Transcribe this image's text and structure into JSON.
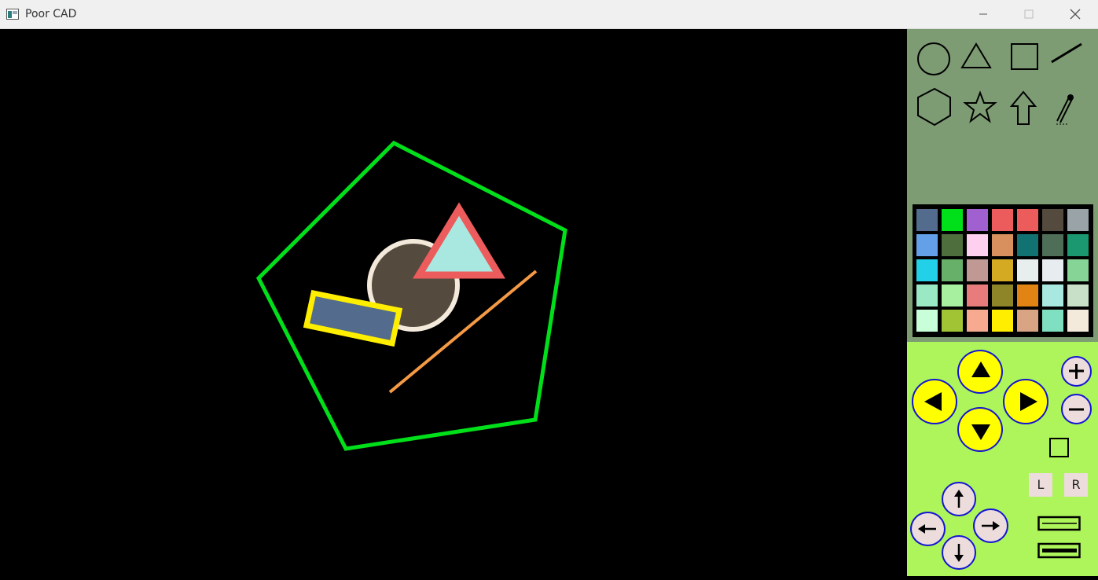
{
  "window": {
    "title": "Poor CAD",
    "controls": [
      "minimize-icon",
      "maximize-icon",
      "close-icon"
    ]
  },
  "canvas": {
    "background": "#000000",
    "shapes": [
      {
        "kind": "pentagon",
        "stroke": "#00e01a",
        "fill": "none"
      },
      {
        "kind": "circle",
        "stroke": "#f4eadc",
        "fill": "#554a3e"
      },
      {
        "kind": "triangle",
        "stroke": "#ec5c5c",
        "fill": "#a8e8e0"
      },
      {
        "kind": "rectangle",
        "stroke": "#ffee00",
        "fill": "#536b8c"
      },
      {
        "kind": "line",
        "stroke": "#f59a44"
      }
    ]
  },
  "tools": [
    "circle-icon",
    "triangle-icon",
    "square-icon",
    "line-icon",
    "hexagon-icon",
    "star-icon",
    "arrow-up-icon",
    "pencil-icon"
  ],
  "palette": [
    [
      "#536b8c",
      "#00e01a",
      "#a060d0",
      "#ec5c5c",
      "#ec5c5c",
      "#554a3e",
      "#9aa3a8"
    ],
    [
      "#64a0e8",
      "#4e6e3e",
      "#fdd0f0",
      "#d8905e",
      "#127272",
      "#4e6e58",
      "#1c9870"
    ],
    [
      "#22d0e8",
      "#66b06a",
      "#c09894",
      "#d4aa22",
      "#e8eeee",
      "#e6ecf0",
      "#86d496"
    ],
    [
      "#9ae8c4",
      "#a6f0a0",
      "#e87c7c",
      "#8e8428",
      "#e28414",
      "#a8e8e0",
      "#c8e0c8"
    ],
    [
      "#c8ffd8",
      "#a0c434",
      "#f8aa90",
      "#ffee00",
      "#d8a484",
      "#7ee0c0",
      "#f4eadc"
    ]
  ],
  "nav": {
    "letter_left": "L",
    "letter_right": "R"
  }
}
